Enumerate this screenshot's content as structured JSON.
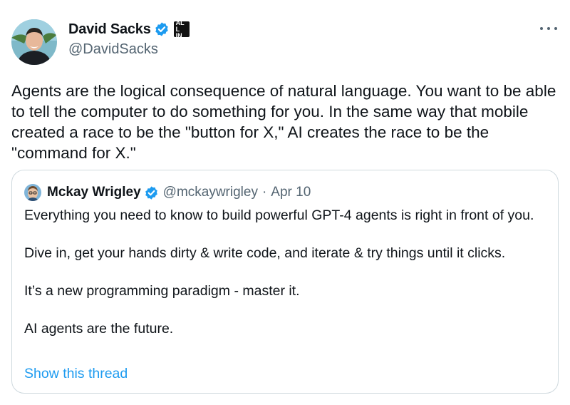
{
  "author": {
    "name": "David Sacks",
    "handle": "@DavidSacks",
    "affiliation_badge": "ALL IN",
    "verified": true
  },
  "menu": {
    "icon": "more-horizontal-icon"
  },
  "tweet": {
    "text": "Agents are the logical consequence of natural language. You want to be able to tell the computer to do something for you. In the same way that mobile created a race to be the \"button for X,\" AI creates the race to be the \"command for X.\""
  },
  "quote": {
    "name": "Mckay Wrigley",
    "handle": "@mckaywrigley",
    "separator": "·",
    "date": "Apr 10",
    "verified": true,
    "paragraphs": [
      "Everything you need to know to build powerful GPT-4 agents is right in front of you.",
      "Dive in, get your hands dirty & write code, and iterate & try things until it clicks.",
      "It’s a new programming paradigm - master it.",
      "AI agents are the future."
    ],
    "show_thread": "Show this thread"
  },
  "colors": {
    "text": "#0f1419",
    "secondary": "#536471",
    "link": "#1d9bf0",
    "verified": "#1d9bf0",
    "border": "#cfd9de"
  }
}
